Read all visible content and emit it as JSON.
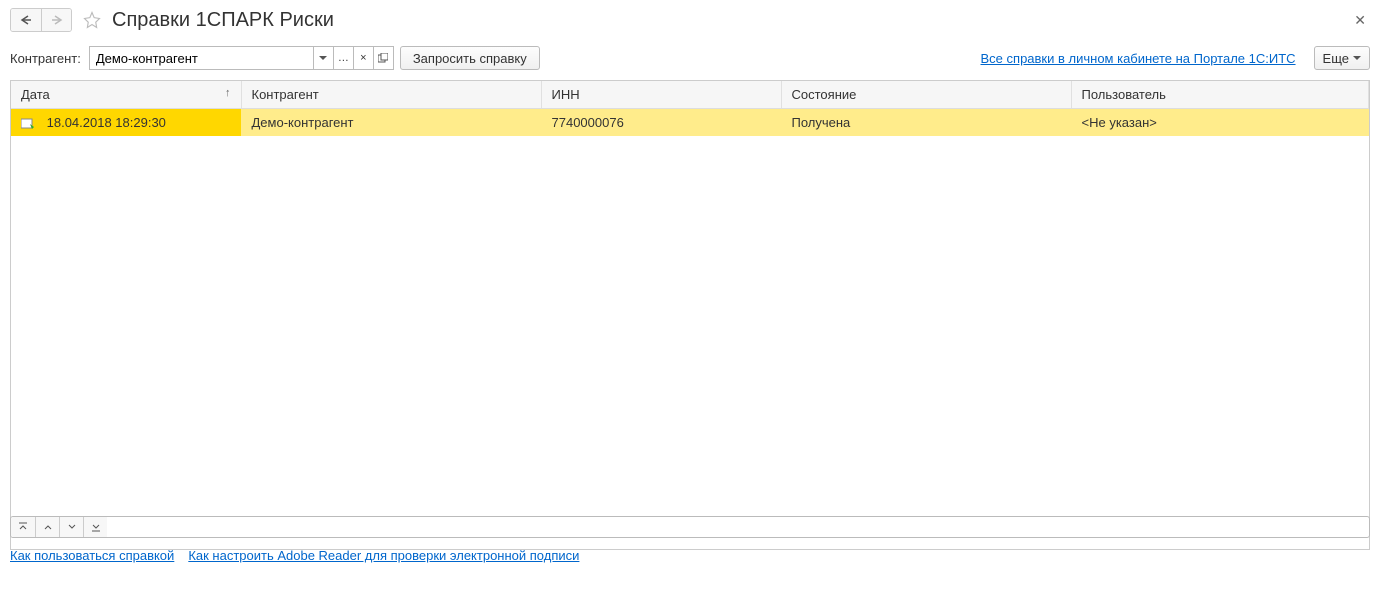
{
  "header": {
    "title": "Справки 1СПАРК Риски"
  },
  "filter": {
    "label": "Контрагент:",
    "value": "Демо-контрагент",
    "request_button": "Запросить справку",
    "portal_link": "Все справки в личном кабинете на Портале 1С:ИТС",
    "more_button": "Еще"
  },
  "table": {
    "columns": {
      "date": "Дата",
      "counterparty": "Контрагент",
      "inn": "ИНН",
      "status": "Состояние",
      "user": "Пользователь"
    },
    "rows": [
      {
        "date": "18.04.2018 18:29:30",
        "counterparty": "Демо-контрагент",
        "inn": "7740000076",
        "status": "Получена",
        "user": "<Не указан>"
      }
    ]
  },
  "footer": {
    "help_link": "Как пользоваться справкой",
    "adobe_link": "Как настроить Adobe Reader для проверки электронной подписи"
  }
}
